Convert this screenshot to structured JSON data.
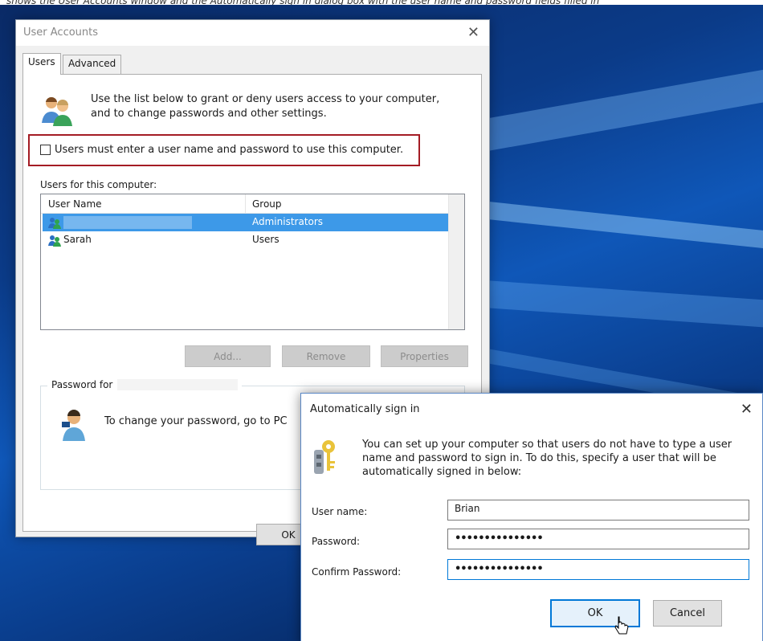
{
  "caption": "shows the User Accounts window and the Automatically sign in dialog box with the user name and password fields filled in",
  "user_accounts": {
    "title": "User Accounts",
    "tabs": [
      {
        "label": "Users",
        "active": true
      },
      {
        "label": "Advanced",
        "active": false
      }
    ],
    "intro": "Use the list below to grant or deny users access to your computer, and to change passwords and other settings.",
    "checkbox_label": "Users must enter a user name and password to use this computer.",
    "checkbox_checked": false,
    "users_label": "Users for this computer:",
    "columns": [
      "User Name",
      "Group"
    ],
    "rows": [
      {
        "name": "",
        "group": "Administrators",
        "selected": true
      },
      {
        "name": "Sarah",
        "group": "Users",
        "selected": false
      }
    ],
    "buttons": {
      "add": "Add...",
      "remove": "Remove",
      "properties": "Properties",
      "ok": "OK"
    },
    "password_group_label": "Password for",
    "password_text": "To change your password, go to PC"
  },
  "auto_sign_in": {
    "title": "Automatically sign in",
    "description": "You can set up your computer so that users do not have to type a user name and password to sign in. To do this, specify a user that will be automatically signed in below:",
    "fields": {
      "username": {
        "label": "User name:",
        "value": "Brian"
      },
      "password": {
        "label": "Password:",
        "value": "•••••••••••••••"
      },
      "confirm": {
        "label": "Confirm Password:",
        "value": "•••••••••••••••"
      }
    },
    "buttons": {
      "ok": "OK",
      "cancel": "Cancel"
    }
  },
  "colors": {
    "highlight_frame": "#a41c24",
    "selection": "#3d99e8",
    "focus": "#0078d7"
  }
}
